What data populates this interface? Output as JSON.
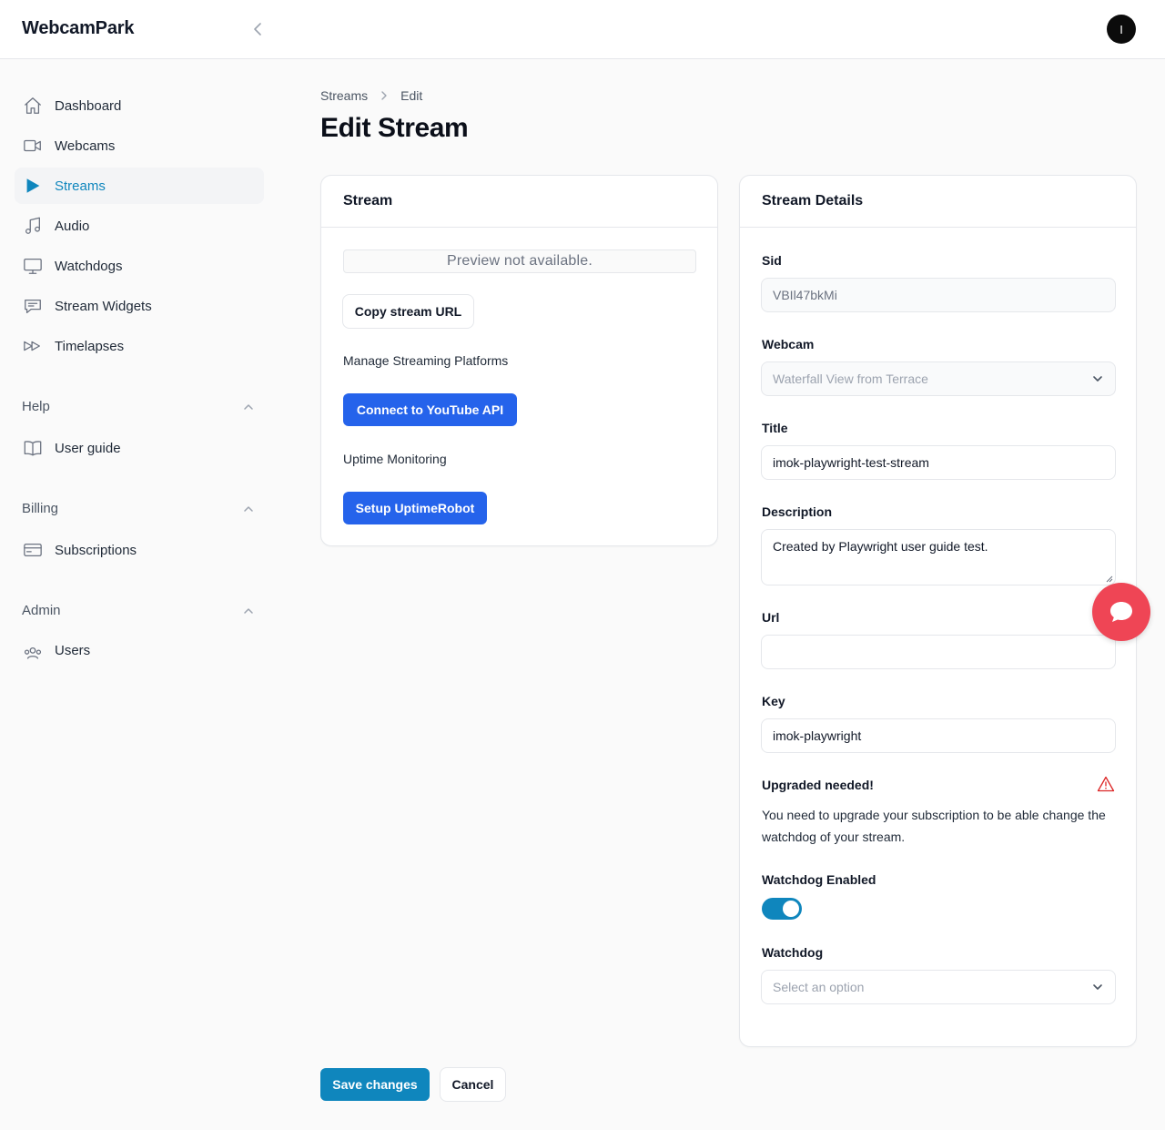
{
  "app": {
    "brand": "WebcamPark",
    "user_initial": "I"
  },
  "sidebar": {
    "items": [
      {
        "label": "Dashboard",
        "icon": "home-icon"
      },
      {
        "label": "Webcams",
        "icon": "video-camera-icon"
      },
      {
        "label": "Streams",
        "icon": "play-icon",
        "active": true
      },
      {
        "label": "Audio",
        "icon": "music-note-icon"
      },
      {
        "label": "Watchdogs",
        "icon": "monitor-icon"
      },
      {
        "label": "Stream Widgets",
        "icon": "chat-bubble-icon"
      },
      {
        "label": "Timelapses",
        "icon": "fast-forward-icon"
      }
    ],
    "groups": {
      "help": {
        "label": "Help",
        "items": [
          {
            "label": "User guide",
            "icon": "book-icon"
          }
        ]
      },
      "billing": {
        "label": "Billing",
        "items": [
          {
            "label": "Subscriptions",
            "icon": "credit-card-icon"
          }
        ]
      },
      "admin": {
        "label": "Admin",
        "items": [
          {
            "label": "Users",
            "icon": "users-icon"
          }
        ]
      }
    }
  },
  "breadcrumb": {
    "parent": "Streams",
    "current": "Edit"
  },
  "page": {
    "title": "Edit Stream"
  },
  "stream_card": {
    "title": "Stream",
    "preview_text": "Preview not available.",
    "copy_url_label": "Copy stream URL",
    "platforms_heading": "Manage Streaming Platforms",
    "youtube_button": "Connect to YouTube API",
    "uptime_heading": "Uptime Monitoring",
    "uptime_button": "Setup UptimeRobot"
  },
  "details_card": {
    "title": "Stream Details",
    "sid": {
      "label": "Sid",
      "value": "VBIl47bkMi"
    },
    "webcam": {
      "label": "Webcam",
      "value": "Waterfall View from Terrace"
    },
    "title_field": {
      "label": "Title",
      "value": "imok-playwright-test-stream"
    },
    "description": {
      "label": "Description",
      "value": "Created by Playwright user guide test."
    },
    "url": {
      "label": "Url",
      "value": ""
    },
    "key": {
      "label": "Key",
      "value": "imok-playwright"
    },
    "upgrade": {
      "title": "Upgraded needed!",
      "text": "You need to upgrade your subscription to be able change the watchdog of your stream."
    },
    "watchdog_enabled": {
      "label": "Watchdog Enabled",
      "checked": true
    },
    "watchdog": {
      "label": "Watchdog",
      "placeholder": "Select an option"
    }
  },
  "actions": {
    "save": "Save changes",
    "cancel": "Cancel"
  },
  "colors": {
    "accent": "#0f86bd",
    "primary_button": "#2563eb",
    "chat_fab": "#ef4555",
    "warning": "#dc2626"
  }
}
